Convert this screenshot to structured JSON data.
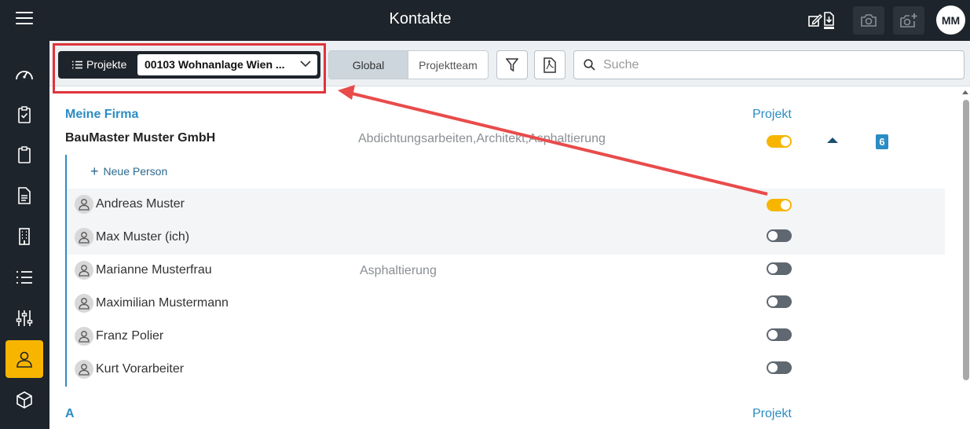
{
  "header": {
    "title": "Kontakte",
    "avatar_initials": "MM",
    "icons": [
      "menu-icon",
      "edit-icon",
      "download-icon",
      "camera-icon",
      "camera-add-icon"
    ]
  },
  "sidebar": {
    "items": [
      {
        "icon": "dashboard-icon"
      },
      {
        "icon": "clipboard-check-icon"
      },
      {
        "icon": "clipboard-icon"
      },
      {
        "icon": "document-icon"
      },
      {
        "icon": "building-icon"
      },
      {
        "icon": "list-icon"
      },
      {
        "icon": "sliders-icon"
      },
      {
        "icon": "person-icon",
        "active": true
      },
      {
        "icon": "cube-icon"
      }
    ]
  },
  "toolbar": {
    "projects_label": "Projekte",
    "project_selected": "00103 Wohnanlage Wien ...",
    "seg_global": "Global",
    "seg_team": "Projektteam",
    "search_placeholder": "Suche"
  },
  "content": {
    "section1": {
      "heading": "Meine Firma",
      "col_heading": "Projekt",
      "company": "BauMaster Muster GmbH",
      "company_trades": "Abdichtungsarbeiten,Architekt,Asphaltierung",
      "badge": "6",
      "new_person": "Neue Person",
      "people": [
        {
          "name": "Andreas Muster",
          "trade": "",
          "project": true
        },
        {
          "name": "Max Muster (ich)",
          "trade": "",
          "project": false
        },
        {
          "name": "Marianne Musterfrau",
          "trade": "Asphaltierung",
          "project": false
        },
        {
          "name": "Maximilian Mustermann",
          "trade": "",
          "project": false
        },
        {
          "name": "Franz Polier",
          "trade": "",
          "project": false
        },
        {
          "name": "Kurt Vorarbeiter",
          "trade": "",
          "project": false
        }
      ]
    },
    "section2": {
      "heading": "A",
      "col_heading": "Projekt"
    }
  },
  "colors": {
    "dark": "#1e242b",
    "accent": "#f7b500",
    "link": "#2b8cc4",
    "annotation": "#e0343b"
  }
}
